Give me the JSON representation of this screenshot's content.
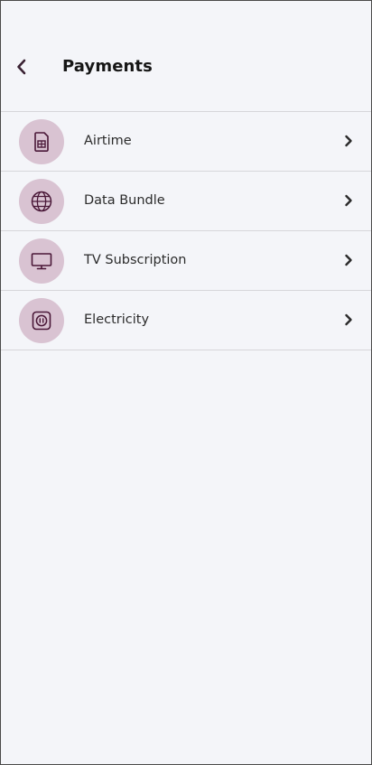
{
  "header": {
    "title": "Payments",
    "back_icon": "chevron-left-icon"
  },
  "colors": {
    "background": "#f4f5f9",
    "icon_circle": "#d9c3d2",
    "icon_stroke": "#4a1838",
    "divider": "#d6d6da"
  },
  "payments": {
    "items": [
      {
        "label": "Airtime",
        "icon": "sim-card-icon"
      },
      {
        "label": "Data Bundle",
        "icon": "globe-icon"
      },
      {
        "label": "TV Subscription",
        "icon": "tv-monitor-icon"
      },
      {
        "label": "Electricity",
        "icon": "power-socket-icon"
      }
    ]
  }
}
